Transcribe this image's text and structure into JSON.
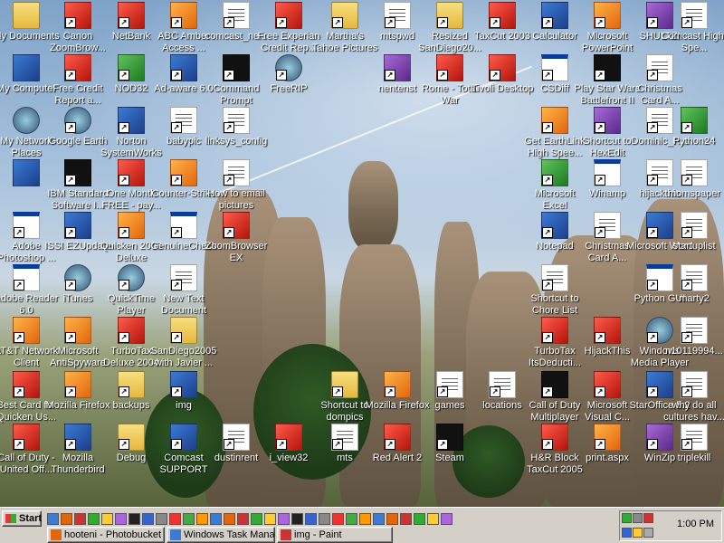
{
  "desktop": {
    "icons": [
      {
        "label": "My Documents",
        "type": "folder"
      },
      {
        "label": "Canon ZoomBrow...",
        "type": "red"
      },
      {
        "label": "NetBank",
        "type": "red"
      },
      {
        "label": "ABC Amber Access ...",
        "type": "orange"
      },
      {
        "label": "comcast_ne...",
        "type": "doc"
      },
      {
        "label": "Free Experian Credit Rep...",
        "type": "red"
      },
      {
        "label": "Martha's Tahoe Pictures",
        "type": "folder"
      },
      {
        "label": "mtspwd",
        "type": "doc"
      },
      {
        "label": "Resized SanDiego20...",
        "type": "folder"
      },
      {
        "label": "TaxCut 2003",
        "type": "red"
      },
      {
        "label": "Calculator",
        "type": "app"
      },
      {
        "label": "Microsoft PowerPoint",
        "type": "orange"
      },
      {
        "label": "SHULTZ!",
        "type": "purple"
      },
      {
        "label": "Comcast High-Spe...",
        "type": "doc"
      },
      {
        "label": "My Computer",
        "type": "app"
      },
      {
        "label": "Free Credit Report a...",
        "type": "red"
      },
      {
        "label": "NOD32",
        "type": "green"
      },
      {
        "label": "Ad-aware 6.0",
        "type": "app"
      },
      {
        "label": "Command Prompt",
        "type": "dark"
      },
      {
        "label": "FreeRIP",
        "type": "net"
      },
      {
        "label": "nentenst",
        "type": "purple"
      },
      {
        "label": "Rome - Total War",
        "type": "red"
      },
      {
        "label": "Tivoli Desktop",
        "type": "red"
      },
      {
        "label": "CSDiff",
        "type": "win"
      },
      {
        "label": "Play Star Wars Battlefront II",
        "type": "dark"
      },
      {
        "label": "Christmas Card A...",
        "type": "doc"
      },
      {
        "label": "My Network Places",
        "type": "net"
      },
      {
        "label": "Google Earth",
        "type": "net"
      },
      {
        "label": "Norton SystemWorks",
        "type": "app"
      },
      {
        "label": "babypic",
        "type": "doc"
      },
      {
        "label": "linksys_config",
        "type": "doc"
      },
      {
        "label": "Get EarthLink High Spee...",
        "type": "orange"
      },
      {
        "label": "Shortcut to HexEdit",
        "type": "purple"
      },
      {
        "label": "Dominic_R...",
        "type": "doc"
      },
      {
        "label": "Python24",
        "type": "green"
      },
      {
        "label": "",
        "type": "app"
      },
      {
        "label": "IBM Standard Software I...",
        "type": "dark"
      },
      {
        "label": "One Month FREE - pay...",
        "type": "red"
      },
      {
        "label": "Counter-Strike",
        "type": "orange"
      },
      {
        "label": "How to email pictures",
        "type": "doc"
      },
      {
        "label": "Microsoft Excel",
        "type": "green"
      },
      {
        "label": "Winamp",
        "type": "win"
      },
      {
        "label": "hijackthis",
        "type": "doc"
      },
      {
        "label": "momspaper",
        "type": "doc"
      },
      {
        "label": "Adobe Photoshop ...",
        "type": "win"
      },
      {
        "label": "ISSI EZUpdate",
        "type": "app"
      },
      {
        "label": "Quicken 2006 Deluxe",
        "type": "orange"
      },
      {
        "label": "GenuineCheck",
        "type": "win"
      },
      {
        "label": "ZoomBrowser EX",
        "type": "red"
      },
      {
        "label": "Notepad",
        "type": "app"
      },
      {
        "label": "Christmas Card A...",
        "type": "doc"
      },
      {
        "label": "Microsoft Word",
        "type": "app"
      },
      {
        "label": "startuplist",
        "type": "doc"
      },
      {
        "label": "Adobe Reader 6.0",
        "type": "win"
      },
      {
        "label": "iTunes",
        "type": "net"
      },
      {
        "label": "QuickTime Player",
        "type": "net"
      },
      {
        "label": "New Text Document",
        "type": "doc"
      },
      {
        "label": "Python GUI",
        "type": "win"
      },
      {
        "label": "marty2",
        "type": "doc"
      },
      {
        "label": "Shortcut to Chore List",
        "type": "doc"
      },
      {
        "label": "AT&T Network Client",
        "type": "orange"
      },
      {
        "label": "Microsoft AntiSpyware",
        "type": "orange"
      },
      {
        "label": "TurboTax Deluxe 2004",
        "type": "red"
      },
      {
        "label": "SanDiego2005 with Javier ...",
        "type": "folder"
      },
      {
        "label": "TurboTax ItsDeducti...",
        "type": "red"
      },
      {
        "label": "HijackThis",
        "type": "red"
      },
      {
        "label": "Windows Media Player",
        "type": "net"
      },
      {
        "label": "n10119994...",
        "type": "doc"
      },
      {
        "label": "Best Card for Quicken Us...",
        "type": "red"
      },
      {
        "label": "Mozilla Firefox",
        "type": "orange"
      },
      {
        "label": "backups",
        "type": "folder"
      },
      {
        "label": "img",
        "type": "app"
      },
      {
        "label": "Shortcut to dompics",
        "type": "folder"
      },
      {
        "label": "Mozilla Firefox",
        "type": "orange"
      },
      {
        "label": "games",
        "type": "doc"
      },
      {
        "label": "locations",
        "type": "doc"
      },
      {
        "label": "Call of Duty Multiplayer",
        "type": "dark"
      },
      {
        "label": "Microsoft Visual C...",
        "type": "red"
      },
      {
        "label": "StarOffice 5.2",
        "type": "app"
      },
      {
        "label": "why do all cultures hav...",
        "type": "doc"
      },
      {
        "label": "Call of Duty - United Off...",
        "type": "red"
      },
      {
        "label": "Mozilla Thunderbird",
        "type": "app"
      },
      {
        "label": "Debug",
        "type": "folder"
      },
      {
        "label": "Comcast SUPPORT",
        "type": "app"
      },
      {
        "label": "dustinrent",
        "type": "doc"
      },
      {
        "label": "i_view32",
        "type": "red"
      },
      {
        "label": "mts",
        "type": "doc"
      },
      {
        "label": "Red Alert 2",
        "type": "red"
      },
      {
        "label": "Steam",
        "type": "dark"
      },
      {
        "label": "H&R Block TaxCut 2005",
        "type": "red"
      },
      {
        "label": "print.aspx",
        "type": "orange"
      },
      {
        "label": "WinZip",
        "type": "purple"
      },
      {
        "label": "triplekill",
        "type": "doc"
      }
    ]
  },
  "taskbar": {
    "start_label": "Start",
    "quicklaunch_count": 30,
    "tasks": [
      {
        "label": "hooteni - Photobucket - Vi..."
      },
      {
        "label": "Windows Task Manager"
      },
      {
        "label": "img - Paint"
      }
    ],
    "clock": "1:00 PM"
  },
  "colors": {
    "taskbar": "#d4d0c8",
    "selection": "#0a246a",
    "sky": "#7fa3c8"
  }
}
